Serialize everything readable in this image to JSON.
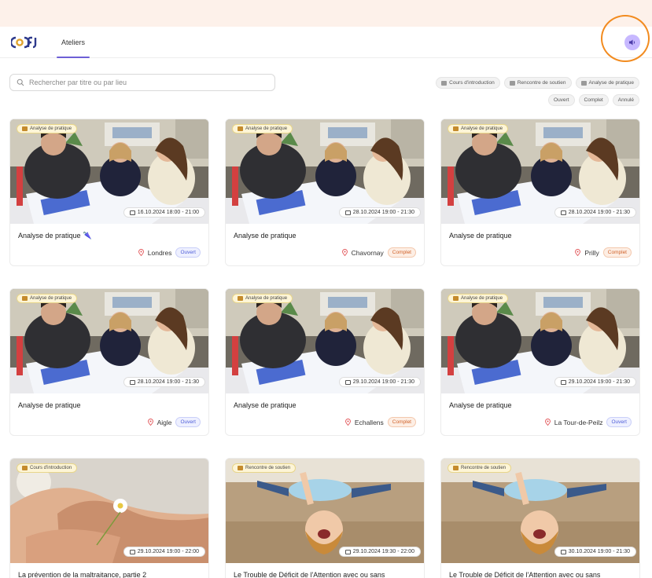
{
  "header": {
    "logo": "CIAFJ",
    "nav_tab": "Ateliers"
  },
  "search": {
    "placeholder": "Rechercher par titre ou par lieu"
  },
  "filters": {
    "categories": [
      "Cours d'introduction",
      "Rencontre de soutien",
      "Analyse de pratique"
    ],
    "statuses": [
      "Ouvert",
      "Complet",
      "Annulé"
    ]
  },
  "cards": [
    {
      "tag": "Analyse de pratique",
      "date": "16.10.2024 18:00 - 21:00",
      "title": "Analyse de pratique",
      "title_icon": "🌂",
      "location": "Londres",
      "status": "Ouvert",
      "status_kind": "ouvert",
      "image": "meeting"
    },
    {
      "tag": "Analyse de pratique",
      "date": "28.10.2024 19:00 - 21:30",
      "title": "Analyse de pratique",
      "location": "Chavornay",
      "status": "Complet",
      "status_kind": "complet",
      "image": "meeting"
    },
    {
      "tag": "Analyse de pratique",
      "date": "28.10.2024 19:00 - 21:30",
      "title": "Analyse de pratique",
      "location": "Prilly",
      "status": "Complet",
      "status_kind": "complet",
      "image": "meeting"
    },
    {
      "tag": "Analyse de pratique",
      "date": "28.10.2024 19:00 - 21:30",
      "title": "Analyse de pratique",
      "location": "Aigle",
      "status": "Ouvert",
      "status_kind": "ouvert",
      "image": "meeting"
    },
    {
      "tag": "Analyse de pratique",
      "date": "29.10.2024 19:00 - 21:30",
      "title": "Analyse de pratique",
      "location": "Echallens",
      "status": "Complet",
      "status_kind": "complet",
      "image": "meeting"
    },
    {
      "tag": "Analyse de pratique",
      "date": "29.10.2024 19:00 - 21:30",
      "title": "Analyse de pratique",
      "location": "La Tour-de-Peilz",
      "status": "Ouvert",
      "status_kind": "ouvert",
      "image": "meeting"
    },
    {
      "tag": "Cours d'introduction",
      "date": "29.10.2024 19:00 - 22:00",
      "title": "La prévention de la maltraitance, partie 2",
      "image": "hands"
    },
    {
      "tag": "Rencontre de soutien",
      "date": "29.10.2024 19:30 - 22:00",
      "title": "Le Trouble de Déficit de l'Attention avec ou sans",
      "image": "child"
    },
    {
      "tag": "Rencontre de soutien",
      "date": "30.10.2024 19:00 - 21:30",
      "title": "Le Trouble de Déficit de l'Attention avec ou sans",
      "image": "child"
    }
  ],
  "colors": {
    "accent": "#6d5fd6",
    "highlight_ring": "#f28b1f",
    "page_bg": "#fdf1ea"
  }
}
